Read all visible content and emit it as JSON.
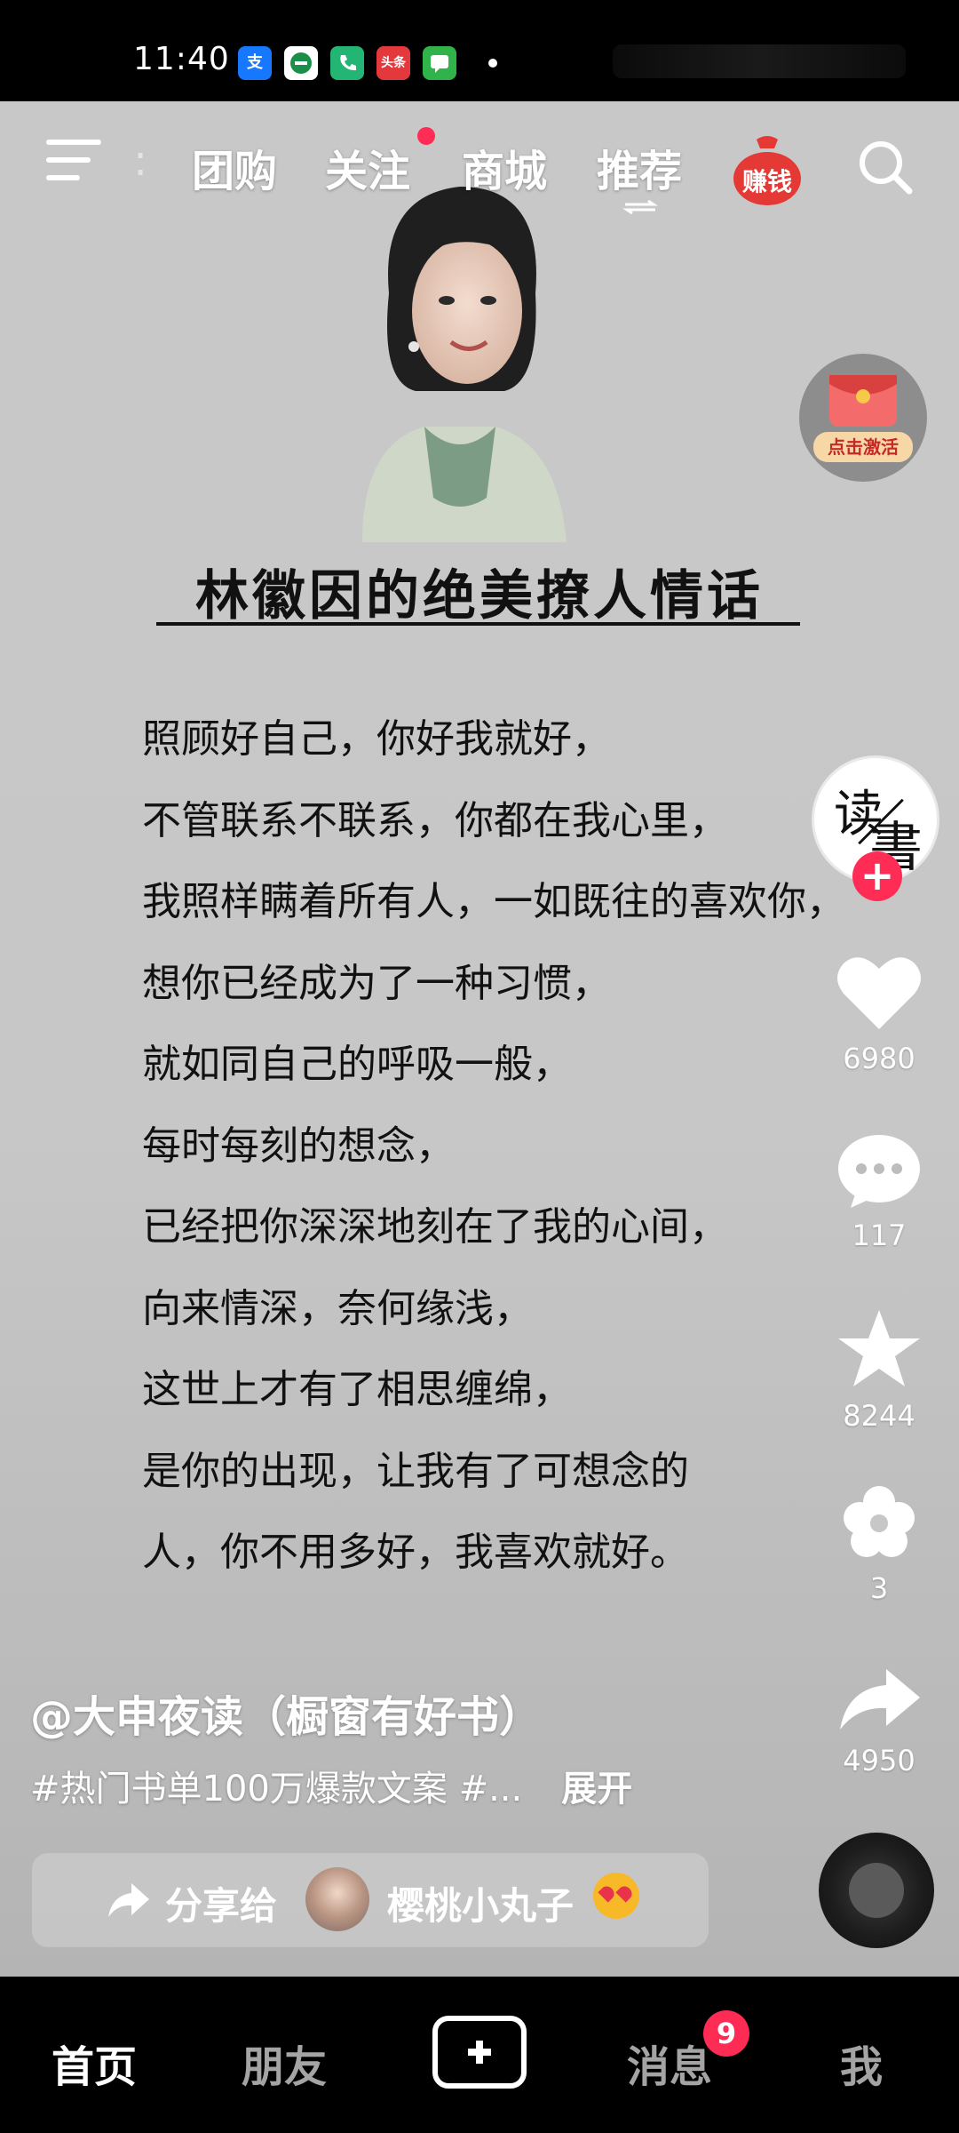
{
  "status_bar": {
    "time": "11:40",
    "apps": [
      {
        "icon": "alipay-icon",
        "glyph": "支",
        "color": "#1677ff"
      },
      {
        "icon": "bank-icon",
        "glyph": "",
        "color": "#1b8f4a"
      },
      {
        "icon": "phone-icon",
        "glyph": "",
        "color": "#22b573"
      },
      {
        "icon": "toutiao-icon",
        "glyph": "头条",
        "color": "#e4393c"
      },
      {
        "icon": "messages-icon",
        "glyph": "",
        "color": "#2fb34a"
      }
    ]
  },
  "top_nav": {
    "tabs": [
      "团购",
      "关注",
      "商城",
      "推荐"
    ],
    "active_tab": "推荐",
    "earn_label": "赚钱"
  },
  "video": {
    "title": "林徽因的绝美撩人情话",
    "poem_lines": [
      "照顾好自己，你好我就好，",
      "不管联系不联系，你都在我心里，",
      "我照样瞒着所有人，一如既往的喜欢你，",
      "想你已经成为了一种习惯，",
      "就如同自己的呼吸一般，",
      "每时每刻的想念，",
      "已经把你深深地刻在了我的心间，",
      "向来情深，奈何缘浅，",
      "这世上才有了相思缠绵，",
      "是你的出现，让我有了可想念的",
      "人，你不用多好，我喜欢就好。"
    ]
  },
  "side_panel": {
    "red_packet_label": "点击激活",
    "avatar_chars": [
      "读",
      "書"
    ],
    "like_count": "6980",
    "comment_count": "117",
    "favorite_count": "8244",
    "flower_count": "3",
    "share_count": "4950"
  },
  "post": {
    "author": "@大申夜读（橱窗有好书）",
    "description": "#热门书单100万爆款文案 #...",
    "expand_label": "展开"
  },
  "share_bar": {
    "label": "分享给",
    "friend_name": "樱桃小丸子"
  },
  "bottom_nav": {
    "home": "首页",
    "friends": "朋友",
    "messages": "消息",
    "messages_badge": "9",
    "me": "我"
  }
}
